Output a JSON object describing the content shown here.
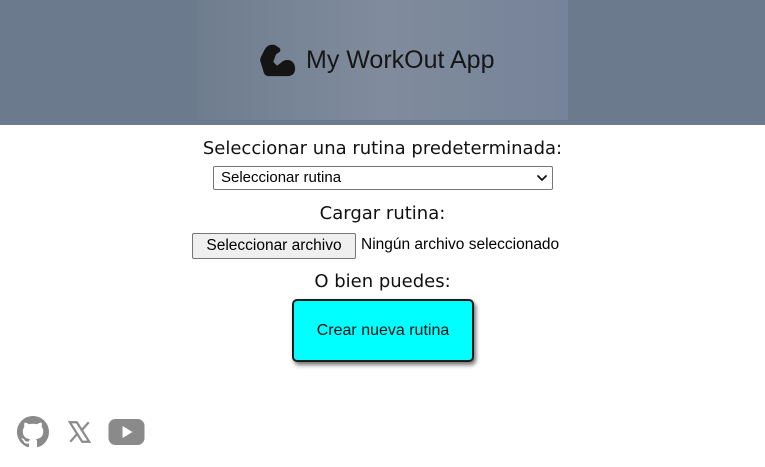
{
  "header": {
    "app_title": "My WorkOut App",
    "logo_icon": "flexed-bicep-icon",
    "background_color": "#6b7a8c"
  },
  "main": {
    "select_label": "Seleccionar una rutina predeterminada:",
    "select_value": "Seleccionar rutina",
    "upload_label": "Cargar rutina:",
    "file_button_label": "Seleccionar archivo",
    "file_status": "Ningún archivo seleccionado",
    "or_label": "O bien puedes:",
    "create_button_label": "Crear nueva rutina",
    "create_button_color": "#00ffff"
  },
  "footer": {
    "social_icons": [
      "github-icon",
      "x-icon",
      "youtube-icon"
    ],
    "icon_color": "#8a8a8a"
  }
}
